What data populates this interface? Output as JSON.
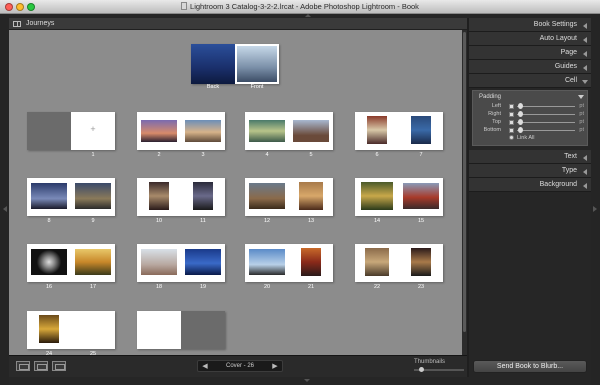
{
  "window": {
    "title": "Lightroom 3 Catalog-3-2-2.lrcat - Adobe Photoshop Lightroom - Book"
  },
  "header": {
    "title": "Journeys",
    "icon": "book-layout-icon"
  },
  "cover": {
    "back_label": "Back",
    "front_label": "Front"
  },
  "pages": {
    "numbers": [
      "1",
      "2",
      "3",
      "4",
      "5",
      "6",
      "7",
      "8",
      "9",
      "10",
      "11",
      "12",
      "13",
      "14",
      "15",
      "16",
      "17",
      "18",
      "19",
      "20",
      "21",
      "22",
      "23",
      "24",
      "25",
      "26"
    ]
  },
  "panel": {
    "sections": [
      {
        "label": "Book Settings",
        "state": "collapsed"
      },
      {
        "label": "Auto Layout",
        "state": "collapsed"
      },
      {
        "label": "Page",
        "state": "collapsed"
      },
      {
        "label": "Guides",
        "state": "collapsed"
      },
      {
        "label": "Cell",
        "state": "expanded"
      },
      {
        "label": "Text",
        "state": "collapsed"
      },
      {
        "label": "Type",
        "state": "collapsed"
      },
      {
        "label": "Background",
        "state": "collapsed"
      }
    ],
    "cell": {
      "padding_title": "Padding",
      "rows": [
        {
          "label": "Left",
          "unit": "pt"
        },
        {
          "label": "Right",
          "unit": "pt"
        },
        {
          "label": "Top",
          "unit": "pt"
        },
        {
          "label": "Bottom",
          "unit": "pt"
        }
      ],
      "link_all": "Link All"
    }
  },
  "toolbar": {
    "view_buttons": [
      "multi-page-view-icon",
      "spread-view-icon",
      "single-page-view-icon"
    ],
    "nav_label": "Cover - 26",
    "prev": "◀",
    "next": "▶",
    "thumbnails_label": "Thumbnails"
  },
  "send_button": "Send Book to Blurb..."
}
